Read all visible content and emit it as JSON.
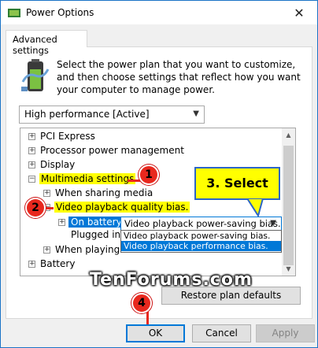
{
  "window": {
    "title": "Power Options",
    "close_glyph": "✕"
  },
  "tab": {
    "label": "Advanced settings"
  },
  "description": "Select the power plan that you want to customize, and then choose settings that reflect how you want your computer to manage power.",
  "plan_select": {
    "value": "High performance [Active]"
  },
  "tree": {
    "items": [
      {
        "label": "PCI Express",
        "expander": "+"
      },
      {
        "label": "Processor power management",
        "expander": "+"
      },
      {
        "label": "Display",
        "expander": "+"
      },
      {
        "label": "Multimedia settings",
        "expander": "−"
      },
      {
        "label": "When sharing media",
        "expander": "+"
      },
      {
        "label": "Video playback quality bias.",
        "expander": "−"
      },
      {
        "label": "On battery:",
        "expander": "+"
      },
      {
        "label": "Plugged in:"
      },
      {
        "label": "When playing video",
        "expander": "+"
      },
      {
        "label": "Battery",
        "expander": "+"
      }
    ]
  },
  "battery_select": {
    "value": "Video playback power-saving bias.",
    "options": [
      "Video playback power-saving bias.",
      "Video playback performance bias."
    ]
  },
  "buttons": {
    "restore": "Restore plan defaults",
    "ok": "OK",
    "cancel": "Cancel",
    "apply": "Apply"
  },
  "annotations": {
    "badge1": "1",
    "badge2": "2",
    "badge4": "4",
    "callout": "3. Select"
  },
  "watermark": "TenForums.com",
  "colors": {
    "accent": "#0078d7",
    "highlight": "#ffff00",
    "badge": "#e8281e"
  }
}
